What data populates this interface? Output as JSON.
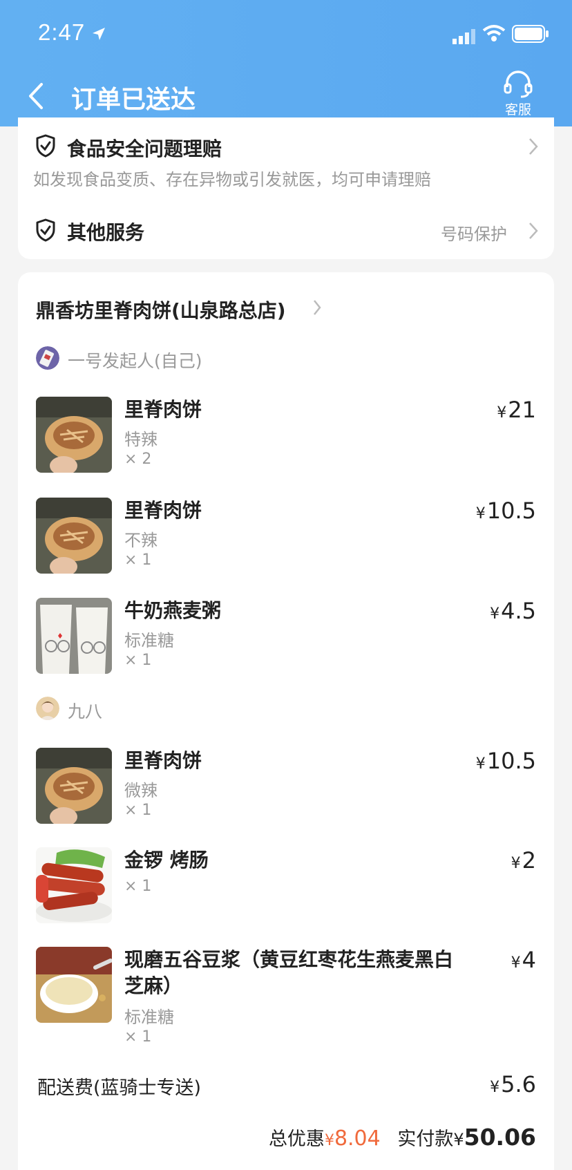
{
  "status_bar": {
    "time": "2:47"
  },
  "header": {
    "title": "订单已送达",
    "customer_service": "客服"
  },
  "services": {
    "food_safety": {
      "title": "食品安全问题理赔",
      "desc": "如发现食品变质、存在异物或引发就医，均可申请理赔"
    },
    "other": {
      "title": "其他服务",
      "right": "号码保护"
    }
  },
  "shop": {
    "name": "鼎香坊里脊肉饼(山泉路总店)"
  },
  "currency": "¥",
  "groups": [
    {
      "person": "一号发起人(自己)",
      "items": [
        {
          "name": "里脊肉饼",
          "spec": "特辣",
          "qty": "× 2",
          "price": "21"
        },
        {
          "name": "里脊肉饼",
          "spec": "不辣",
          "qty": "× 1",
          "price": "10.5"
        },
        {
          "name": "牛奶燕麦粥",
          "spec": "标准糖",
          "qty": "× 1",
          "price": "4.5"
        }
      ]
    },
    {
      "person": "九八",
      "items": [
        {
          "name": "里脊肉饼",
          "spec": "微辣",
          "qty": "× 1",
          "price": "10.5"
        },
        {
          "name": "金锣 烤肠",
          "spec": "",
          "qty": "× 1",
          "price": "2"
        },
        {
          "name": "现磨五谷豆浆（黄豆红枣花生燕麦黑白芝麻）",
          "spec": "标准糖",
          "qty": "× 1",
          "price": "4"
        }
      ]
    }
  ],
  "delivery": {
    "label": "配送费(蓝骑士专送)",
    "price": "5.6"
  },
  "summary": {
    "discount_label": "总优惠",
    "discount": "8.04",
    "paid_label": "实付款",
    "paid": "50.06"
  },
  "colors": {
    "header": "#5aa8f0",
    "discount": "#f06a3c"
  }
}
